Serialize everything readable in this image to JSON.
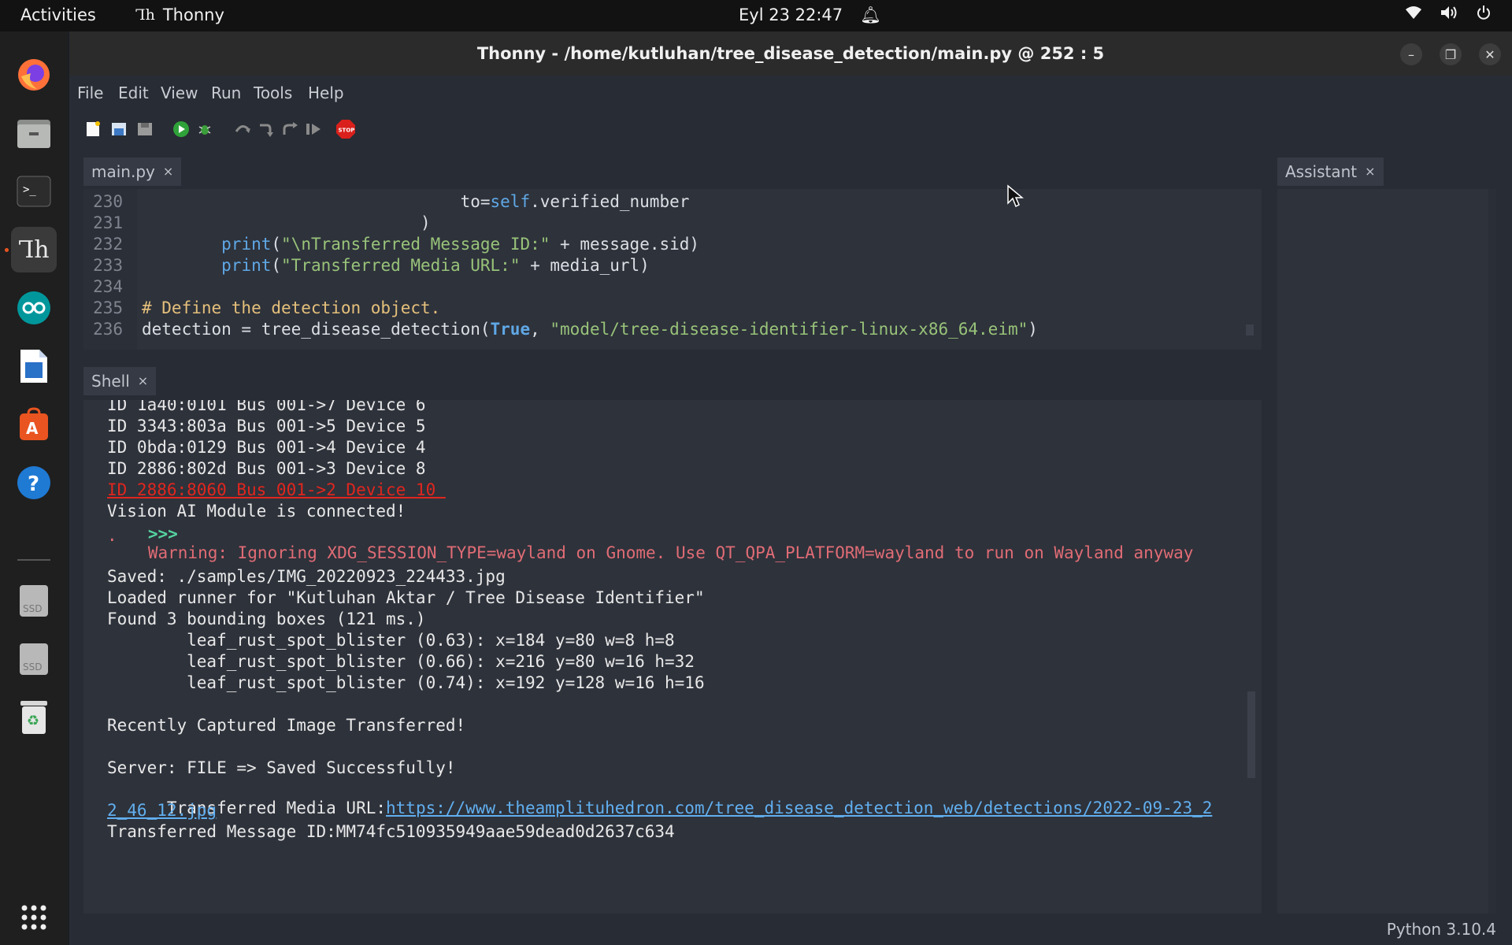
{
  "topbar": {
    "activities": "Activities",
    "app_name": "Thonny",
    "app_icon": "thonny-th-icon",
    "clock": "Eyl 23  22:47",
    "icons": [
      "bell-icon",
      "wifi-icon",
      "volume-icon",
      "power-icon"
    ]
  },
  "dock": {
    "items": [
      "firefox-icon",
      "files-icon",
      "terminal-icon",
      "thonny-icon",
      "arduino-icon",
      "libreoffice-writer-icon",
      "software-center-icon",
      "help-icon",
      "ssd-drive-icon",
      "ssd-drive-icon",
      "trash-icon",
      "show-apps-grid-icon"
    ]
  },
  "window": {
    "title": "Thonny - /home/kutluhan/tree_disease_detection/main.py  @  252 : 5"
  },
  "menu": [
    "File",
    "Edit",
    "View",
    "Run",
    "Tools",
    "Help"
  ],
  "toolbar": {
    "icons": [
      "new-file-icon",
      "open-file-icon",
      "save-file-icon",
      "run-icon",
      "debug-icon",
      "step-over-icon",
      "step-into-icon",
      "step-out-icon",
      "resume-icon",
      "stop-icon"
    ],
    "stop_label": "STOP"
  },
  "editor": {
    "tab_label": "main.py",
    "tab_close": "×",
    "lines": [
      {
        "no": "230",
        "text": "                                to=self.verified_number"
      },
      {
        "no": "231",
        "text": "                            )"
      },
      {
        "no": "232",
        "text": "        print(\"\\nTransferred Message ID:\" + message.sid)"
      },
      {
        "no": "233",
        "text": "        print(\"Transferred Media URL:\" + media_url)"
      },
      {
        "no": "234",
        "text": ""
      },
      {
        "no": "235",
        "text": "# Define the detection object."
      },
      {
        "no": "236",
        "text": "detection = tree_disease_detection(True, \"model/tree-disease-identifier-linux-x86_64.eim\")"
      }
    ]
  },
  "shell": {
    "tab_label": "Shell",
    "tab_close": "×",
    "lines": [
      {
        "text": "ID 1a40:0101 Bus 001->7 Device 6",
        "style": "normal"
      },
      {
        "text": "ID 3343:803a Bus 001->5 Device 5",
        "style": "normal"
      },
      {
        "text": "ID 0bda:0129 Bus 001->4 Device 4",
        "style": "normal"
      },
      {
        "text": "ID 2886:802d Bus 001->3 Device 8",
        "style": "normal"
      },
      {
        "text": "ID 2886:8060 Bus 001->2 Device 10 ",
        "style": "error"
      },
      {
        "text": "Vision AI Module is connected!",
        "style": "normal"
      }
    ],
    "prompt": ">>>",
    "warning": "Warning: Ignoring XDG_SESSION_TYPE=wayland on Gnome. Use QT_QPA_PLATFORM=wayland to run on Wayland anyway",
    "warning_cont": ".",
    "output": [
      "Saved: ./samples/IMG_20220923_224433.jpg",
      "Loaded runner for \"Kutluhan Aktar / Tree Disease Identifier\"",
      "Found 3 bounding boxes (121 ms.)",
      "        leaf_rust_spot_blister (0.63): x=184 y=80 w=8 h=8",
      "        leaf_rust_spot_blister (0.66): x=216 y=80 w=16 h=32",
      "        leaf_rust_spot_blister (0.74): x=192 y=128 w=16 h=16",
      "",
      "Recently Captured Image Transferred!",
      "",
      "Server: FILE => Saved Successfully!",
      "",
      "",
      "Transferred Message ID:MM74fc510935949aae59dead0d2637c634"
    ],
    "media_label": "Transferred Media URL:",
    "media_url_1": "https://www.theamplituhedron.com/tree_disease_detection_web/detections/2022-09-23_2",
    "media_url_2": "2_46_12.jpg"
  },
  "assistant": {
    "tab_label": "Assistant",
    "tab_close": "×"
  },
  "status": {
    "python": "Python 3.10.4"
  }
}
